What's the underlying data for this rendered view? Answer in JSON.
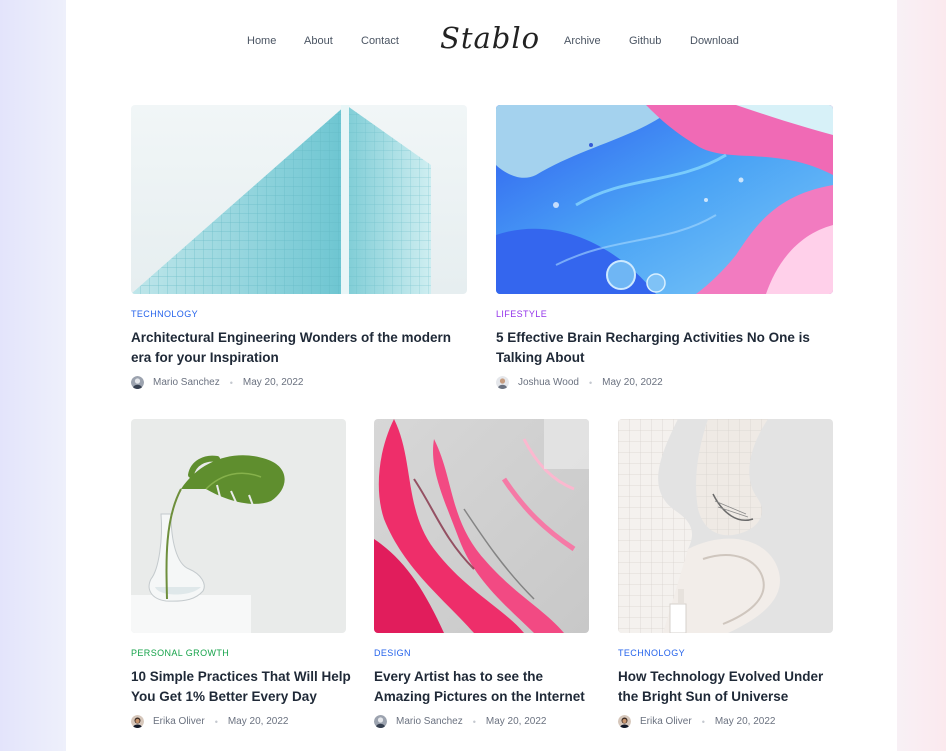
{
  "brand": {
    "logo": "Stablo"
  },
  "nav": {
    "left": [
      "Home",
      "About",
      "Contact"
    ],
    "right": [
      "Archive",
      "Github",
      "Download"
    ]
  },
  "posts": [
    {
      "category": "Technology",
      "category_color": "#2563eb",
      "title": "Architectural Engineering Wonders of the modern era for your Inspiration",
      "author": "Mario Sanchez",
      "date": "May 20, 2022",
      "image": "glass-building"
    },
    {
      "category": "Lifestyle",
      "category_color": "#9333ea",
      "title": "5 Effective Brain Recharging Activities No One is Talking About",
      "author": "Joshua Wood",
      "date": "May 20, 2022",
      "image": "fluid-paint"
    },
    {
      "category": "Personal Growth",
      "category_color": "#16a34a",
      "title": "10 Simple Practices That Will Help You Get 1% Better Every Day",
      "author": "Erika Oliver",
      "date": "May 20, 2022",
      "image": "plant-vase"
    },
    {
      "category": "Design",
      "category_color": "#2563eb",
      "title": "Every Artist has to see the Amazing Pictures on the Internet",
      "author": "Mario Sanchez",
      "date": "May 20, 2022",
      "image": "pink-paint"
    },
    {
      "category": "Technology",
      "category_color": "#2563eb",
      "title": "How Technology Evolved Under the Bright Sun of Universe",
      "author": "Erika Oliver",
      "date": "May 20, 2022",
      "image": "curved-building"
    }
  ]
}
